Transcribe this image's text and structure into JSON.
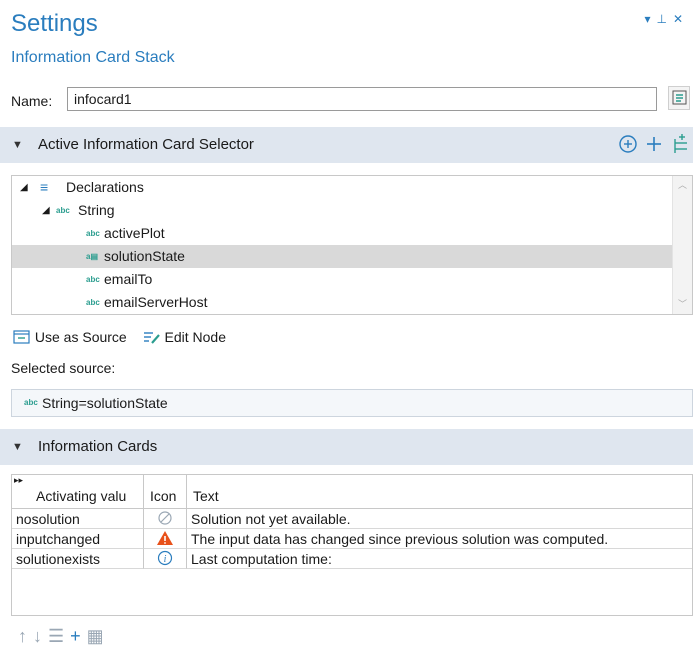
{
  "header": {
    "title": "Settings",
    "subtitle": "Information Card Stack"
  },
  "name_field": {
    "label": "Name:",
    "value": "infocard1"
  },
  "selector_section": {
    "label": "Active Information Card Selector",
    "tree": {
      "root": "Declarations",
      "group": "String",
      "items": [
        "activePlot",
        "solutionState",
        "emailTo",
        "emailServerHost"
      ],
      "selected": "solutionState",
      "type_badge": "abc"
    }
  },
  "tree_toolbar": {
    "use_as_source": "Use as Source",
    "edit_node": "Edit Node"
  },
  "selected_source": {
    "label": "Selected source:",
    "value": "String=solutionState"
  },
  "info_cards_section": {
    "label": "Information Cards",
    "columns": [
      "Activating valu",
      "Icon",
      "Text"
    ],
    "rows": [
      {
        "value": "nosolution",
        "icon": "not-available-icon",
        "text": "Solution not yet available."
      },
      {
        "value": "inputchanged",
        "icon": "warning-icon",
        "text": "The input data has changed since previous solution was computed."
      },
      {
        "value": "solutionexists",
        "icon": "info-icon",
        "text": "Last computation time:"
      }
    ]
  },
  "colors": {
    "accent": "#2a7dbe",
    "teal": "#2a9d8f",
    "warning": "#e8511a",
    "section_bg": "#dfe6ef"
  }
}
